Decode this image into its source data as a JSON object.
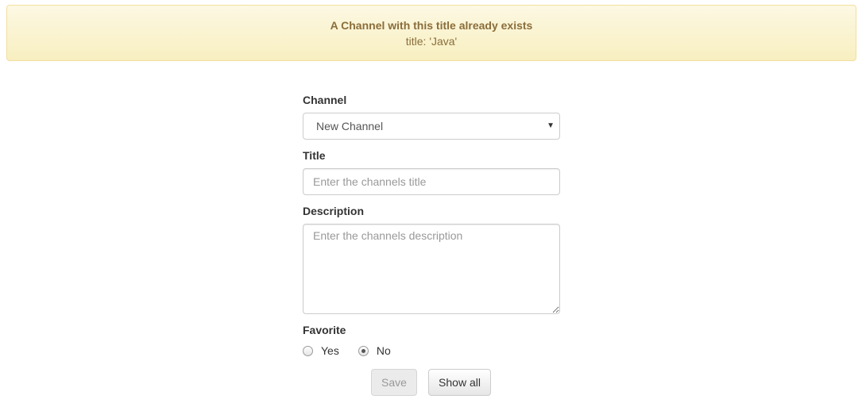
{
  "alert": {
    "title": "A Channel with this title already exists",
    "detail": "title: 'Java'"
  },
  "form": {
    "channel": {
      "label": "Channel",
      "selected": "New Channel"
    },
    "title": {
      "label": "Title",
      "value": "",
      "placeholder": "Enter the channels title"
    },
    "description": {
      "label": "Description",
      "value": "",
      "placeholder": "Enter the channels description"
    },
    "favorite": {
      "label": "Favorite",
      "options": [
        "Yes",
        "No"
      ],
      "selected": "No"
    }
  },
  "buttons": {
    "save": "Save",
    "show_all": "Show all"
  }
}
